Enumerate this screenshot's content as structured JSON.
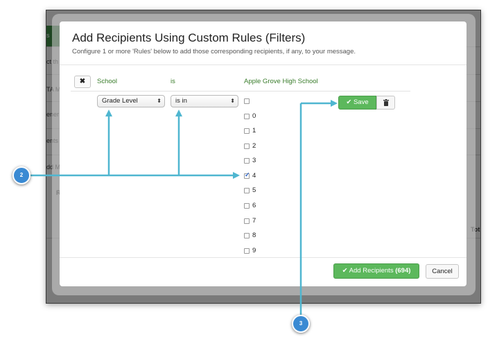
{
  "background": {
    "fragments": [
      "s",
      "ct th",
      "TA M",
      "ener",
      "ents",
      "dd M",
      "R",
      "Tot"
    ]
  },
  "modal": {
    "title": "Add Recipients Using Custom Rules (Filters)",
    "subtitle": "Configure 1 or more 'Rules' below to add those corresponding recipients, if any, to your message.",
    "rule": {
      "remove_icon": "close-icon",
      "field": "School",
      "operator": "is",
      "value": "Apple Grove High School",
      "sub_field_select": "Grade Level",
      "sub_operator_select": "is in",
      "options": [
        {
          "label": "",
          "checked": false
        },
        {
          "label": "0",
          "checked": false
        },
        {
          "label": "1",
          "checked": false
        },
        {
          "label": "2",
          "checked": false
        },
        {
          "label": "3",
          "checked": false
        },
        {
          "label": "4",
          "checked": true
        },
        {
          "label": "5",
          "checked": false
        },
        {
          "label": "6",
          "checked": false
        },
        {
          "label": "7",
          "checked": false
        },
        {
          "label": "8",
          "checked": false
        },
        {
          "label": "9",
          "checked": false
        }
      ],
      "save_label": "Save",
      "save_icon": "check-icon",
      "delete_icon": "trash-icon"
    },
    "footer": {
      "add_label": "Add Recipients",
      "add_count": "(694)",
      "cancel_label": "Cancel"
    }
  },
  "annotations": {
    "badge_2": "2",
    "badge_3": "3",
    "color": "#4fb6d0"
  }
}
